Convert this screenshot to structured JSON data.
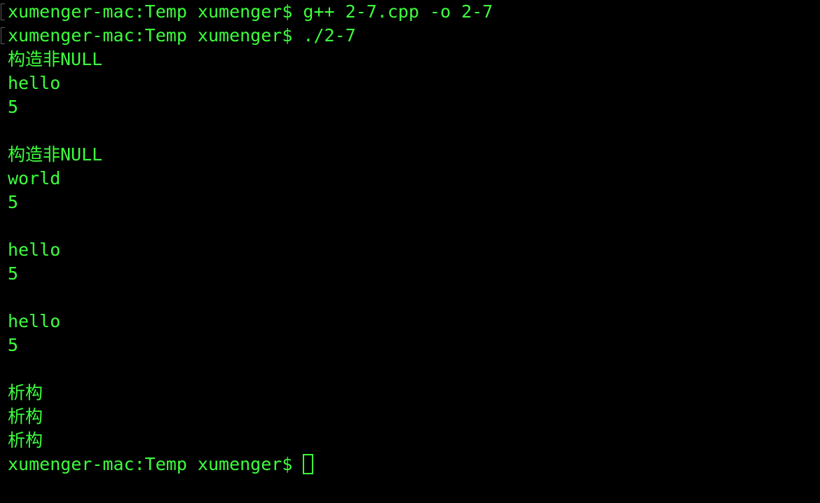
{
  "terminal": {
    "text_color": "#3dff3d",
    "background_color": "#000000",
    "lines": [
      "xumenger-mac:Temp xumenger$ g++ 2-7.cpp -o 2-7",
      "xumenger-mac:Temp xumenger$ ./2-7",
      "构造非NULL",
      "hello",
      "5",
      "",
      "构造非NULL",
      "world",
      "5",
      "",
      "hello",
      "5",
      "",
      "hello",
      "5",
      "",
      "析构",
      "析构",
      "析构"
    ],
    "prompt": "xumenger-mac:Temp xumenger$ "
  }
}
